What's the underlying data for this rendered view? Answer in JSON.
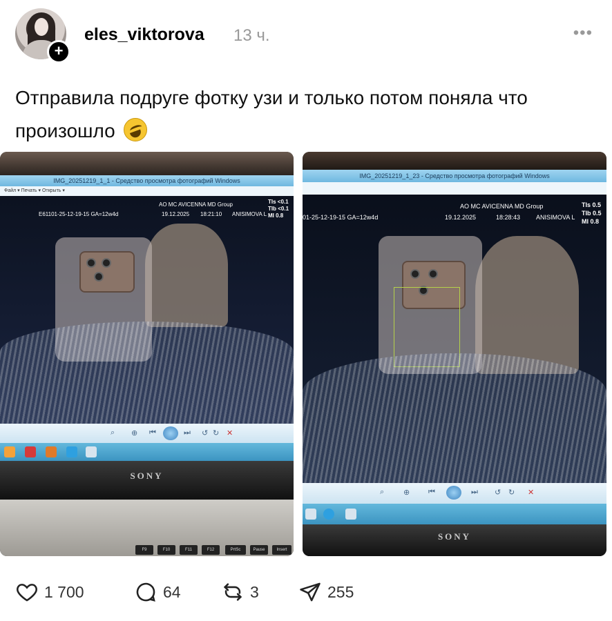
{
  "post": {
    "username": "eles_viktorova",
    "time": "13 ч.",
    "more_label": "•••",
    "follow_label": "+",
    "text": "Отправила подруге фотку узи и только потом поняла что произошло",
    "emoji_name": "rolling-on-floor-laughing"
  },
  "photos": [
    {
      "window_title": "IMG_20251219_1_1 - Средство просмотра фотографий Windows",
      "menu": "Файл ▾   Печать ▾   Открыть ▾",
      "clinic": "AO MC AVICENNA MD Group",
      "id_line": "E61101-25-12-19-15  GA=12w4d",
      "date": "19.12.2025",
      "clock": "18:21:10",
      "operator": "ANISIMOVA L",
      "tis": "TIs <0.1",
      "tib": "TIb <0.1",
      "mi": "MI  0.8",
      "brand": "SONY",
      "keys": [
        "F9",
        "F10",
        "F11",
        "F12",
        "PrtSc SysRq",
        "Pause Break",
        "Insert"
      ]
    },
    {
      "window_title": "IMG_20251219_1_23 - Средство просмотра фотографий Windows",
      "clinic": "AO MC AVICENNA MD Group",
      "id_line": "01-25-12-19-15  GA=12w4d",
      "date": "19.12.2025",
      "clock": "18:28:43",
      "operator": "ANISIMOVA L",
      "tis": "TIs  0.5",
      "tib": "TIb  0.5",
      "mi": "MI  0.8",
      "brand": "SONY"
    }
  ],
  "actions": {
    "likes": "1 700",
    "comments": "64",
    "reposts": "3",
    "shares": "255"
  },
  "icons": {
    "like": "heart-icon",
    "comment": "comment-bubble-icon",
    "repost": "repost-arrows-icon",
    "share": "send-paper-plane-icon"
  }
}
